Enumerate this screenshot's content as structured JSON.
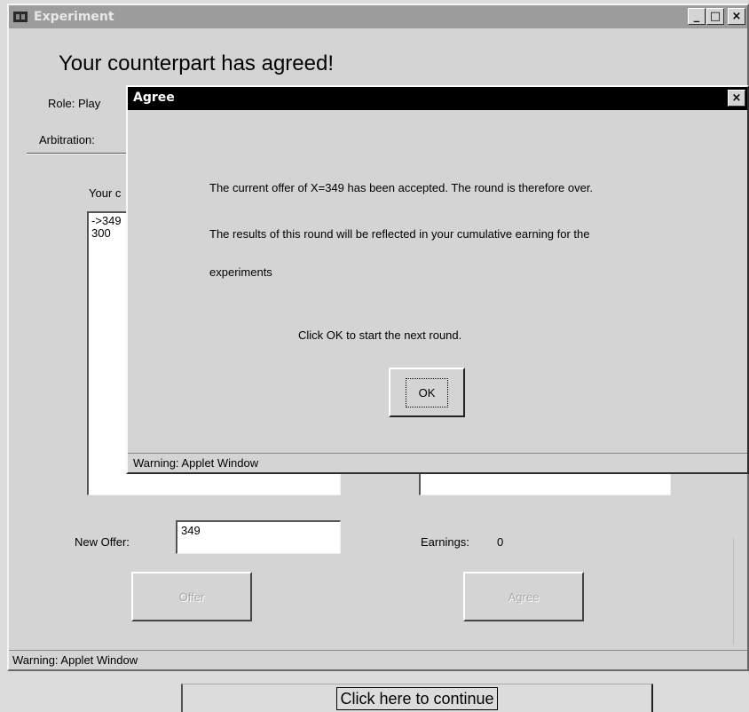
{
  "window": {
    "title": "Experiment",
    "minimize": "_",
    "maximize": "□",
    "close": "×"
  },
  "main": {
    "heading": "Your counterpart has agreed!",
    "role_label": "Role:",
    "role_value": "Play",
    "arbitration_label": "Arbitration:",
    "your_label": "Your c",
    "offers": [
      "->349",
      "300"
    ],
    "new_offer_label": "New Offer:",
    "new_offer_value": "349",
    "earnings_label": "Earnings:",
    "earnings_value": "0",
    "offer_button": "Offer",
    "agree_button": "Agree",
    "warning": "Warning: Applet Window"
  },
  "dialog": {
    "title": "Agree",
    "close": "×",
    "line1": "The current offer of X=349 has been accepted. The round is therefore over.",
    "line2": "The results of this round will be reflected in your cumulative earning for the",
    "line3": "experiments",
    "line4": "Click OK to start the next round.",
    "ok_button": "OK",
    "warning": "Warning: Applet Window"
  },
  "continue_button": "Click here to continue"
}
